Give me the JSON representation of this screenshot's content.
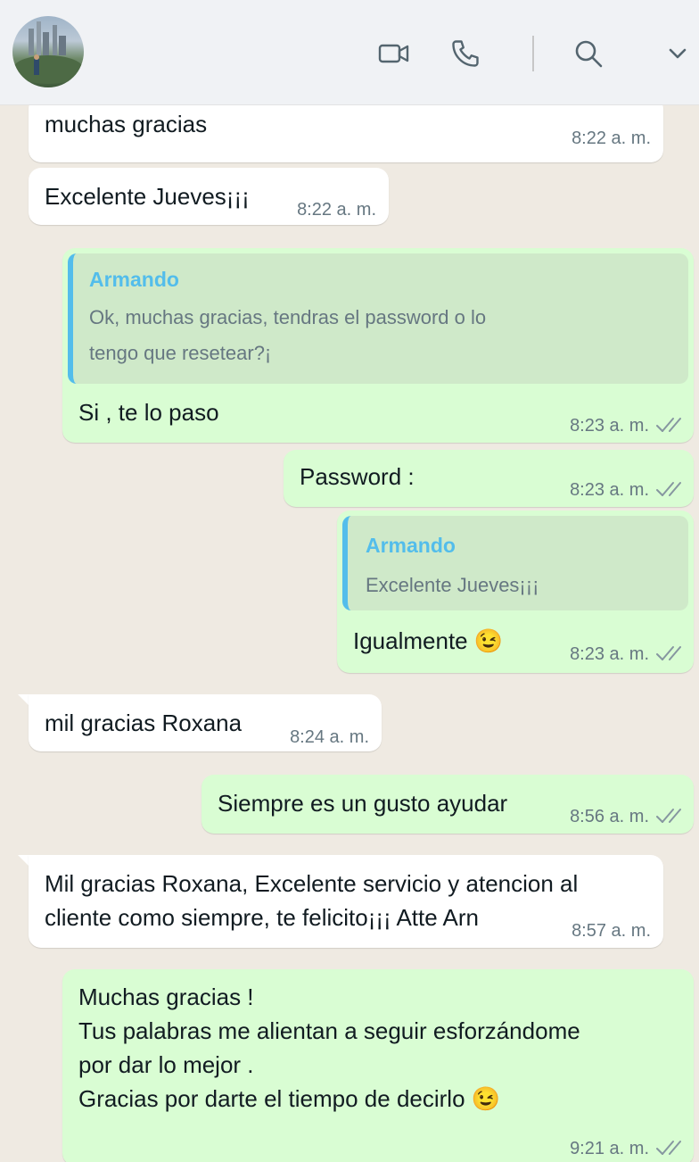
{
  "header": {
    "contact_name": "",
    "icons": [
      "video-call-icon",
      "phone-icon",
      "search-icon",
      "chevron-down-icon"
    ]
  },
  "messages": [
    {
      "dir": "in",
      "text": "muchas gracias",
      "time": "8:22 a. m."
    },
    {
      "dir": "in",
      "text": "Excelente Jueves¡¡¡",
      "time": "8:22 a. m."
    },
    {
      "dir": "out",
      "quote_name": "Armando",
      "quote_text": "Ok, muchas gracias, tendras el password o lo\ntengo que resetear?¡",
      "text": "Si , te lo paso",
      "time": "8:23 a. m."
    },
    {
      "dir": "out",
      "text": "Password :",
      "time": "8:23 a. m."
    },
    {
      "dir": "out",
      "quote_name": "Armando",
      "quote_text": "Excelente Jueves¡¡¡",
      "text": "Igualmente 😉",
      "time": "8:23 a. m."
    },
    {
      "dir": "in",
      "text": "mil gracias Roxana",
      "time": "8:24 a. m."
    },
    {
      "dir": "out",
      "text": "Siempre es un gusto ayudar",
      "time": "8:56 a. m."
    },
    {
      "dir": "in",
      "text": "Mil gracias Roxana, Excelente servicio y atencion al\ncliente como siempre, te felicito¡¡¡ Atte Arn",
      "time": "8:57 a. m."
    },
    {
      "dir": "out",
      "text": "Muchas gracias !\nTus palabras me alientan a seguir esforzándome\npor dar lo mejor .\nGracias por darte el tiempo de decirlo 😉",
      "time": "9:21 a. m."
    }
  ],
  "colors": {
    "incoming": "#ffffff",
    "outgoing": "#d9fdd3",
    "quote_accent": "#53bdeb",
    "read_ticks": "#8696a0",
    "background": "#efeae2"
  }
}
